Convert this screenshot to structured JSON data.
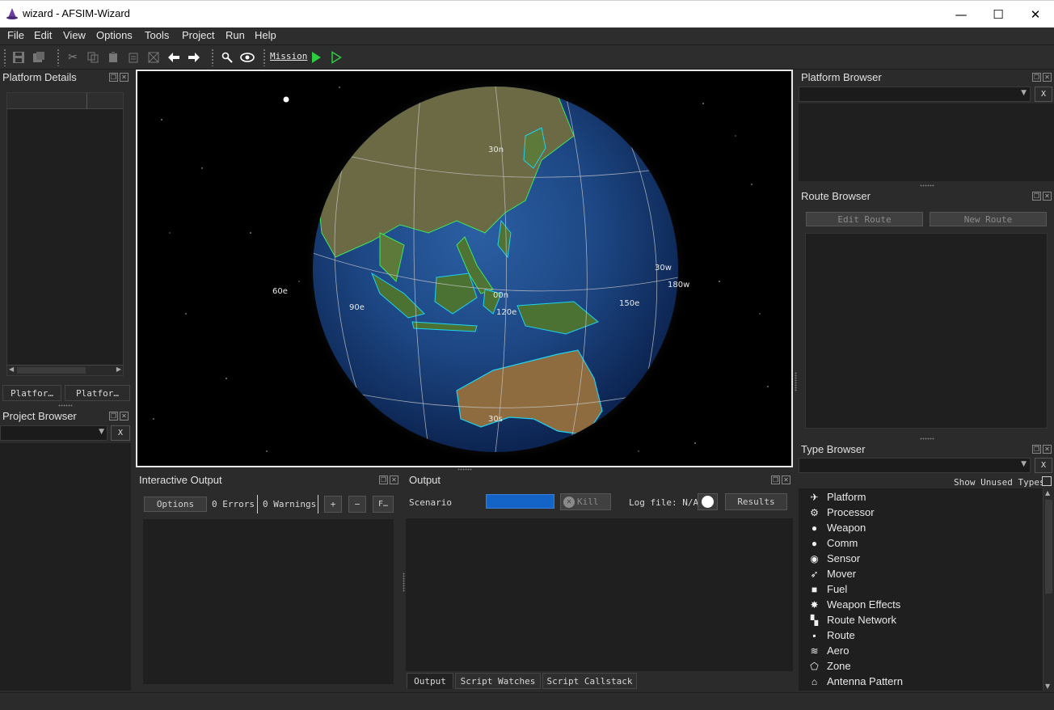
{
  "window": {
    "title": "wizard - AFSIM-Wizard",
    "minimize_icon": "minimize-icon",
    "maximize_icon": "maximize-icon",
    "close_icon": "close-icon",
    "min_glyph": "—",
    "max_glyph": "☐",
    "close_glyph": "✕"
  },
  "menu": [
    "File",
    "Edit",
    "View",
    "Options",
    "Tools",
    "Project",
    "Run",
    "Help"
  ],
  "toolbar": {
    "mission_label": "Mission",
    "icons": [
      "save-icon",
      "save-all-icon",
      "cut-icon",
      "copy-icon",
      "paste-icon",
      "paste-special-icon",
      "format-icon",
      "back-arrow-icon",
      "forward-arrow-icon",
      "search-icon",
      "eye-icon",
      "play-icon",
      "play-outline-icon"
    ]
  },
  "platform_details": {
    "title": "Platform Details",
    "tabs": [
      "Platfor…",
      "Platfor…"
    ]
  },
  "project_browser": {
    "title": "Project Browser",
    "x_label": "X"
  },
  "globe": {
    "grid_labels": [
      "30n",
      "00n",
      "30s",
      "60e",
      "90e",
      "120e",
      "150e",
      "180w",
      "30w"
    ]
  },
  "interactive_output": {
    "title": "Interactive Output",
    "options_label": "Options",
    "errors_label": "0 Errors",
    "warnings_label": "0 Warnings",
    "plus_label": "+",
    "minus_label": "−",
    "filter_label": "F…"
  },
  "output": {
    "title": "Output",
    "scenario_label": "Scenario",
    "kill_label": "Kill",
    "log_file_label": "Log file: N/A",
    "results_label": "Results",
    "progress_color": "#1464c8",
    "tabs": [
      "Output",
      "Script Watches",
      "Script Callstack"
    ]
  },
  "platform_browser": {
    "title": "Platform Browser",
    "x_label": "X"
  },
  "route_browser": {
    "title": "Route Browser",
    "edit_route_label": "Edit Route",
    "new_route_label": "New Route"
  },
  "type_browser": {
    "title": "Type Browser",
    "x_label": "X",
    "show_unused_label": "Show Unused Types",
    "items": [
      {
        "label": "Platform",
        "icon": "aircraft-icon"
      },
      {
        "label": "Processor",
        "icon": "gears-icon"
      },
      {
        "label": "Weapon",
        "icon": "bomb-icon"
      },
      {
        "label": "Comm",
        "icon": "speech-bubble-icon"
      },
      {
        "label": "Sensor",
        "icon": "satellite-dish-icon"
      },
      {
        "label": "Mover",
        "icon": "bird-icon"
      },
      {
        "label": "Fuel",
        "icon": "fuel-icon"
      },
      {
        "label": "Weapon Effects",
        "icon": "explosion-icon"
      },
      {
        "label": "Route Network",
        "icon": "network-icon"
      },
      {
        "label": "Route",
        "icon": "route-icon"
      },
      {
        "label": "Aero",
        "icon": "wing-icon"
      },
      {
        "label": "Zone",
        "icon": "zone-icon"
      },
      {
        "label": "Antenna Pattern",
        "icon": "antenna-icon"
      }
    ]
  }
}
